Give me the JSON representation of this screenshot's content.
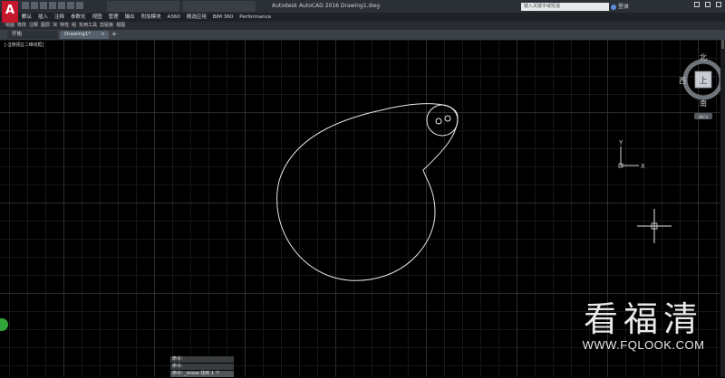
{
  "window": {
    "title": "Autodesk AutoCAD 2016    Drawing1.dwg",
    "search_placeholder": "键入关键字或短语",
    "user_label": "登录"
  },
  "app_logo": "A",
  "ribbon_tabs": [
    "默认",
    "插入",
    "注释",
    "参数化",
    "视图",
    "管理",
    "输出",
    "附加模块",
    "A360",
    "精选应用",
    "BIM 360",
    "Performance"
  ],
  "tools_menu": [
    "绘图",
    "修改",
    "注释",
    "图层",
    "块",
    "特性",
    "组",
    "实用工具",
    "剪贴板",
    "视图"
  ],
  "file_tabs": {
    "start": "开始",
    "drawing": "Drawing1*"
  },
  "viewport_label": "[-][俯视][二维线框]",
  "viewcube": {
    "north": "北",
    "south": "南",
    "west": "西",
    "east": "东",
    "face": "上",
    "wcs": "WCS"
  },
  "ucs": {
    "x_label": "X",
    "y_label": "Y"
  },
  "command_history": [
    "命令:",
    "命令:"
  ],
  "command_current": "命令: _erase 找到 1 个",
  "watermark": {
    "chinese": "看福清",
    "url": "WWW.FQLOOK.COM"
  },
  "colors": {
    "accent": "#3c8ee8",
    "logo": "#c5172b",
    "status": "#31a53b"
  }
}
